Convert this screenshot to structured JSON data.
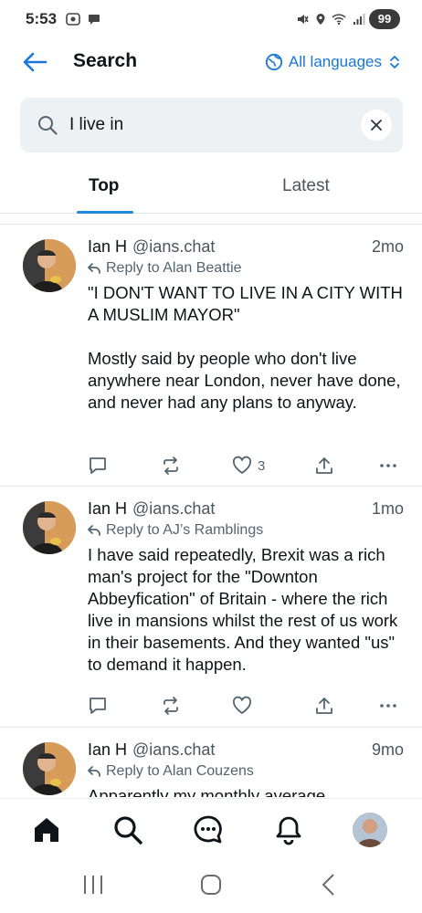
{
  "status_bar": {
    "time": "5:53",
    "battery": "99",
    "left_icons": [
      "screenshot-icon",
      "chat-bubble-icon"
    ],
    "right_icons": [
      "mute-icon",
      "location-icon",
      "wifi-icon",
      "signal-icon"
    ]
  },
  "header": {
    "title": "Search",
    "language_label": "All languages"
  },
  "search": {
    "value": "I live in"
  },
  "tabs": [
    {
      "label": "Top",
      "active": true
    },
    {
      "label": "Latest",
      "active": false
    }
  ],
  "posts": [
    {
      "author": "Ian H",
      "handle": "@ians.chat",
      "time": "2mo",
      "reply_to": "Reply to Alan Beattie",
      "text": "\"I DON'T WANT TO LIVE IN A CITY WITH A MUSLIM MAYOR\"\n\nMostly said by people who don't live anywhere near London, never have done, and never had any plans to anyway.",
      "likes": "3"
    },
    {
      "author": "Ian H",
      "handle": "@ians.chat",
      "time": "1mo",
      "reply_to": "Reply to AJ’s Ramblings",
      "text": "I have said repeatedly, Brexit was a rich man's project for the \"Downton Abbeyfication\" of Britain - where the rich live in mansions whilst the rest of us work in their basements. And they wanted \"us\" to demand it happen.",
      "likes": ""
    },
    {
      "author": "Ian H",
      "handle": "@ians.chat",
      "time": "9mo",
      "reply_to": "Reply to Alan Couzens",
      "text": "Apparently my monthly average",
      "likes": ""
    }
  ],
  "bottom_nav": [
    "home-icon",
    "search-icon",
    "chat-icon",
    "bell-icon",
    "profile-avatar"
  ],
  "colors": {
    "accent": "#1d8ae0",
    "link": "#1877d6",
    "text": "#0f1419",
    "muted": "#536471"
  }
}
